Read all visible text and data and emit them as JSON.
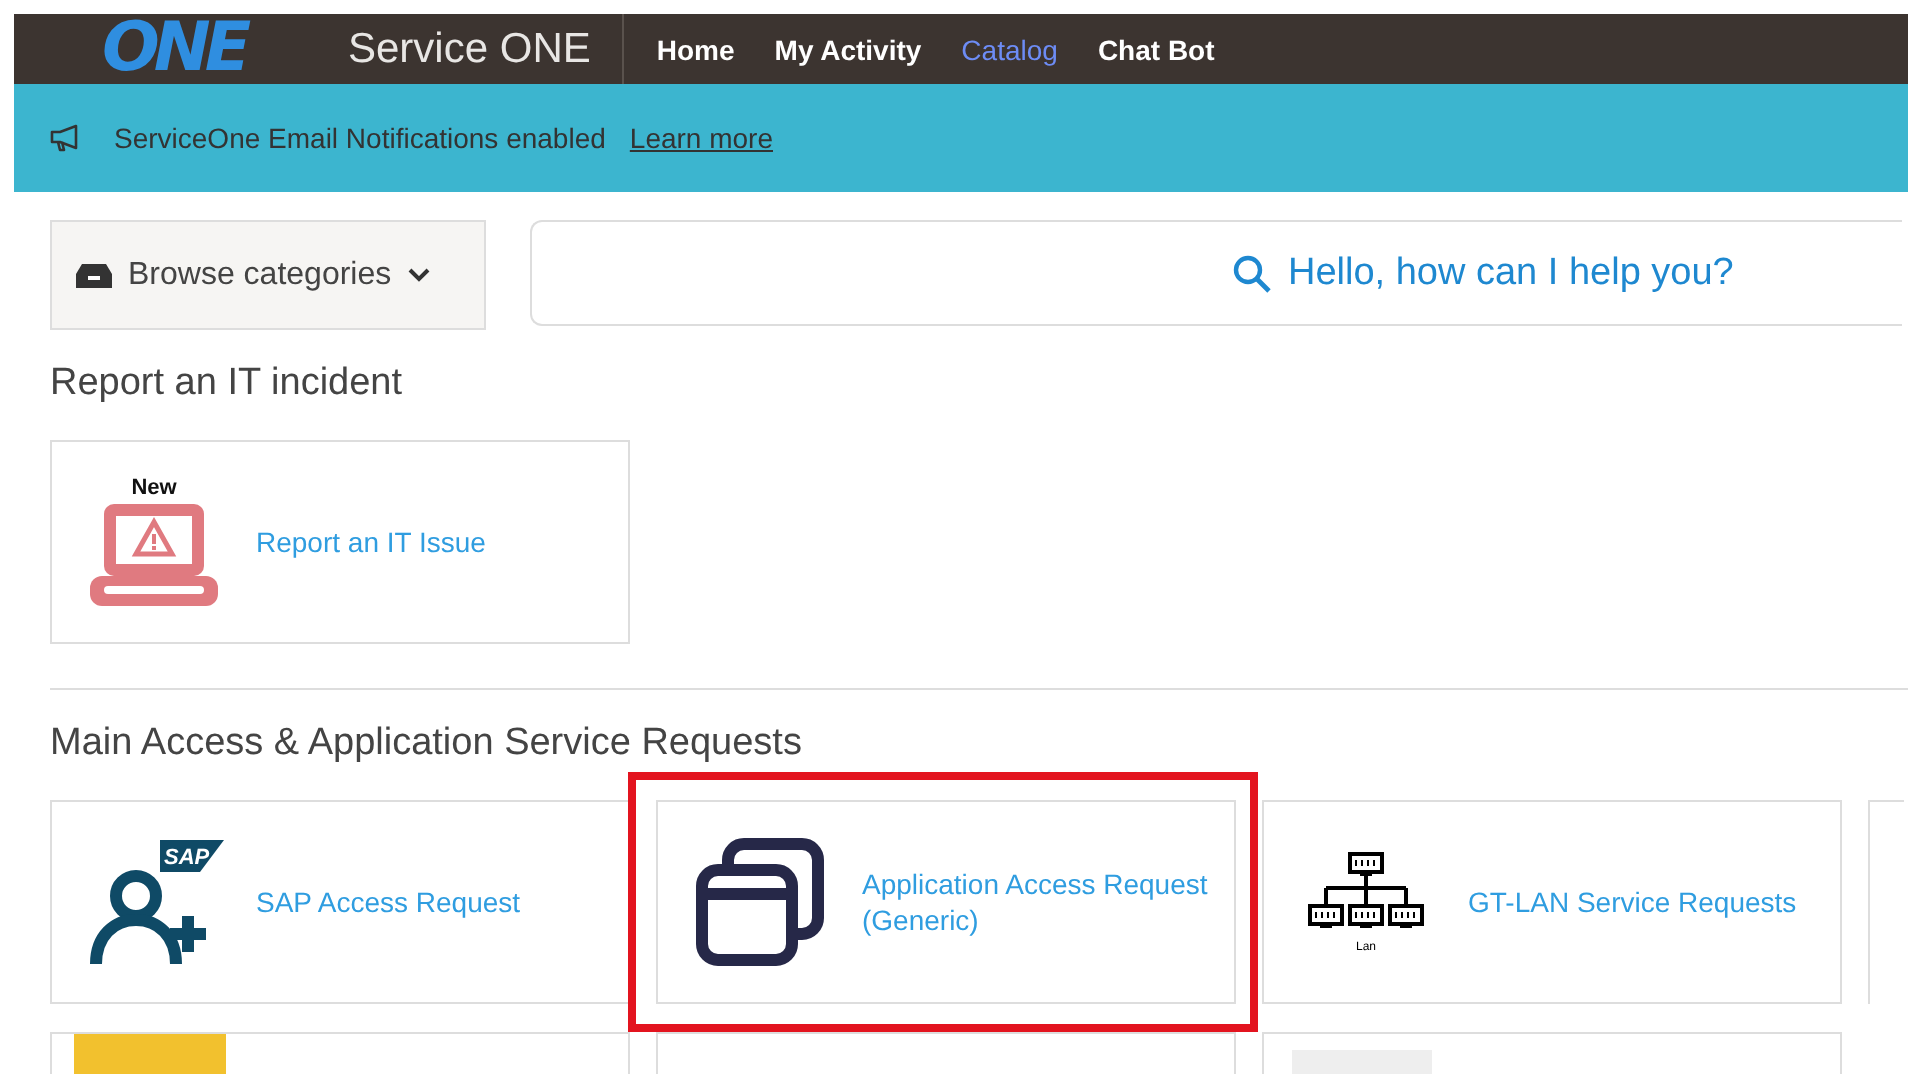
{
  "header": {
    "logo": "ONE",
    "title": "Service ONE",
    "nav": [
      {
        "label": "Home",
        "selected": false
      },
      {
        "label": "My Activity",
        "selected": false
      },
      {
        "label": "Catalog",
        "selected": true
      },
      {
        "label": "Chat Bot",
        "selected": false
      }
    ]
  },
  "notification": {
    "text": "ServiceOne Email Notifications enabled",
    "link": "Learn more"
  },
  "browse": {
    "label": "Browse categories"
  },
  "search": {
    "placeholder": "Hello, how can I help you?"
  },
  "sections": [
    {
      "title": "Report an IT incident",
      "cards": [
        {
          "label": "Report an IT Issue",
          "kind": "laptop",
          "badge": "New",
          "highlighted": false
        }
      ]
    },
    {
      "title": "Main Access & Application Service Requests",
      "cards": [
        {
          "label": "SAP Access Request",
          "kind": "user",
          "icon_text": "SAP",
          "highlighted": false
        },
        {
          "label": "Application Access Request (Generic)",
          "kind": "windows",
          "highlighted": true
        },
        {
          "label": "GT-LAN Service Requests",
          "kind": "network",
          "icon_text": "Lan",
          "highlighted": false
        },
        {
          "kind": "blank",
          "highlighted": false
        },
        {
          "kind": "photo",
          "highlighted": false
        },
        {
          "kind": "blank",
          "highlighted": false
        },
        {
          "kind": "thumb",
          "highlighted": false
        }
      ]
    }
  ]
}
